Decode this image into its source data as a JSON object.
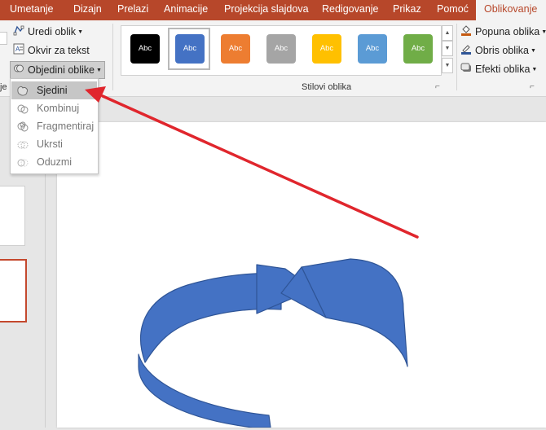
{
  "tabs": [
    {
      "label": "Umetanje",
      "active": false
    },
    {
      "label": "Dizajn",
      "active": false
    },
    {
      "label": "Prelazi",
      "active": false
    },
    {
      "label": "Animacije",
      "active": false
    },
    {
      "label": "Projekcija slajdova",
      "active": false
    },
    {
      "label": "Redigovanje",
      "active": false
    },
    {
      "label": "Prikaz",
      "active": false
    },
    {
      "label": "Pomoć",
      "active": false
    },
    {
      "label": "Oblikovanje",
      "active": true
    }
  ],
  "ribbon": {
    "edit_shape": "Uredi oblik",
    "text_box": "Okvir za tekst",
    "merge_shapes": "Objedini oblike",
    "styles_group_label": "Stilovi oblika",
    "shape_fill": "Popuna oblika",
    "shape_outline": "Obris oblika",
    "shape_effects": "Efekti oblika",
    "left_partial": "je",
    "style_swatches": [
      {
        "label": "Abc",
        "color": "#000000",
        "selected": false
      },
      {
        "label": "Abc",
        "color": "#4472c4",
        "selected": true
      },
      {
        "label": "Abc",
        "color": "#ed7d31",
        "selected": false
      },
      {
        "label": "Abc",
        "color": "#a5a5a5",
        "selected": false
      },
      {
        "label": "Abc",
        "color": "#ffc000",
        "selected": false
      },
      {
        "label": "Abc",
        "color": "#5b9bd5",
        "selected": false
      },
      {
        "label": "Abc",
        "color": "#70ad47",
        "selected": false
      }
    ]
  },
  "merge_menu": {
    "items": [
      {
        "label": "Sjedini",
        "highlighted": true,
        "enabled": true
      },
      {
        "label": "Kombinuj",
        "highlighted": false,
        "enabled": false
      },
      {
        "label": "Fragmentiraj",
        "highlighted": false,
        "enabled": false
      },
      {
        "label": "Ukrsti",
        "highlighted": false,
        "enabled": false
      },
      {
        "label": "Oduzmi",
        "highlighted": false,
        "enabled": false
      }
    ]
  },
  "colors": {
    "tab_bar": "#b7472a",
    "shape_fill": "#4472c4",
    "shape_outline": "#2f5597",
    "annotation_arrow": "#e0262d"
  }
}
